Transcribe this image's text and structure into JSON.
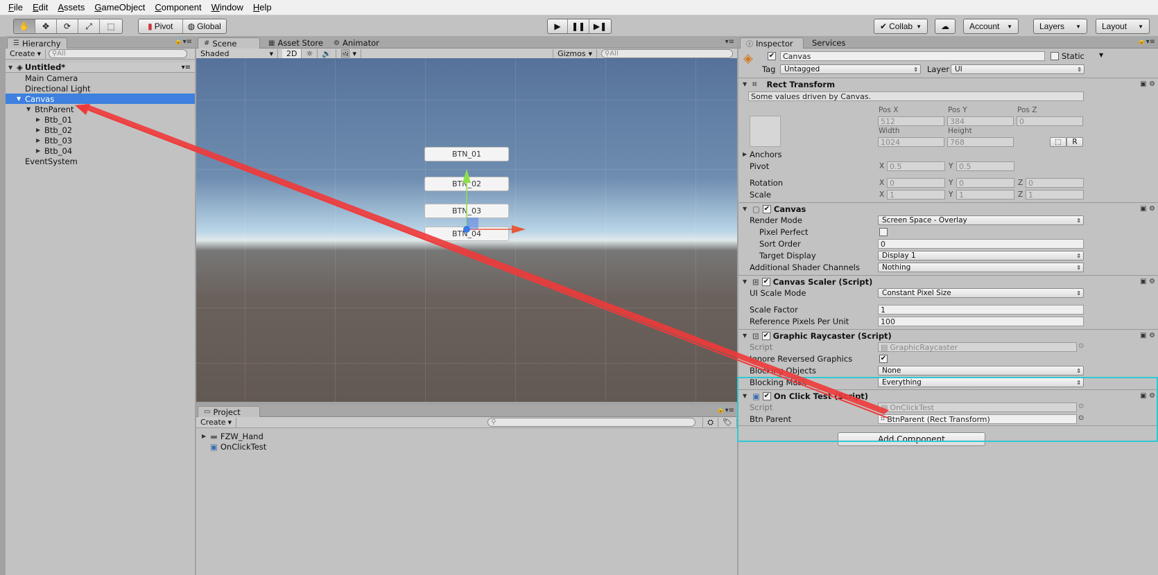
{
  "menu": [
    "File",
    "Edit",
    "Assets",
    "GameObject",
    "Component",
    "Window",
    "Help"
  ],
  "toolbar": {
    "pivot": "Pivot",
    "global": "Global",
    "collab": "Collab",
    "account": "Account",
    "layers": "Layers",
    "layout": "Layout"
  },
  "hierarchy": {
    "tab": "Hierarchy",
    "create": "Create",
    "search_placeholder": "All",
    "scene_name": "Untitled*",
    "items": [
      "Main Camera",
      "Directional Light",
      "Canvas",
      "BtnParent",
      "Btb_01",
      "Btb_02",
      "Btb_03",
      "Btb_04",
      "EventSystem"
    ]
  },
  "scene": {
    "tabs": [
      "Scene",
      "Asset Store",
      "Animator"
    ],
    "shaded": "Shaded",
    "mode2d": "2D",
    "gizmos": "Gizmos",
    "search_placeholder": "All",
    "buttons": [
      "BTN_01",
      "BTN_02",
      "BTN_03",
      "BTN_04"
    ]
  },
  "project": {
    "tab": "Project",
    "create": "Create",
    "items": [
      "FZW_Hand",
      "OnClickTest"
    ]
  },
  "inspector": {
    "tabs": [
      "Inspector",
      "Services"
    ],
    "object_name": "Canvas",
    "static": "Static",
    "tag_label": "Tag",
    "tag_value": "Untagged",
    "layer_label": "Layer",
    "layer_value": "UI",
    "rect": {
      "title": "Rect Transform",
      "note": "Some values driven by Canvas.",
      "pos_x_label": "Pos X",
      "pos_y_label": "Pos Y",
      "pos_z_label": "Pos Z",
      "pos_x": "512",
      "pos_y": "384",
      "pos_z": "0",
      "width_label": "Width",
      "height_label": "Height",
      "width": "1024",
      "height": "768",
      "anchors": "Anchors",
      "pivot": "Pivot",
      "pivot_x": "0.5",
      "pivot_y": "0.5",
      "rotation": "Rotation",
      "rot_x": "0",
      "rot_y": "0",
      "rot_z": "0",
      "scale": "Scale",
      "scale_x": "1",
      "scale_y": "1",
      "scale_z": "1",
      "r_btn": "R"
    },
    "canvas": {
      "title": "Canvas",
      "render_mode_label": "Render Mode",
      "render_mode": "Screen Space - Overlay",
      "pixel_perfect": "Pixel Perfect",
      "sort_order_label": "Sort Order",
      "sort_order": "0",
      "target_display_label": "Target Display",
      "target_display": "Display 1",
      "shader_channels_label": "Additional Shader Channels",
      "shader_channels": "Nothing"
    },
    "scaler": {
      "title": "Canvas Scaler (Script)",
      "ui_scale_mode_label": "UI Scale Mode",
      "ui_scale_mode": "Constant Pixel Size",
      "scale_factor_label": "Scale Factor",
      "scale_factor": "1",
      "ref_ppu_label": "Reference Pixels Per Unit",
      "ref_ppu": "100"
    },
    "raycaster": {
      "title": "Graphic Raycaster (Script)",
      "script_label": "Script",
      "script": "GraphicRaycaster",
      "ignore_reversed": "Ignore Reversed Graphics",
      "blocking_objects_label": "Blocking Objects",
      "blocking_objects": "None",
      "blocking_mask_label": "Blocking Mask",
      "blocking_mask": "Everything"
    },
    "onclick": {
      "title": "On Click Test (Script)",
      "script_label": "Script",
      "script": "OnClickTest",
      "btn_parent_label": "Btn Parent",
      "btn_parent": "BtnParent (Rect Transform)"
    },
    "add_component": "Add Component"
  },
  "colors": {
    "selection": "#3d80df",
    "annotation_arrow": "#f03a3a",
    "annotation_box": "#30c8d0"
  }
}
